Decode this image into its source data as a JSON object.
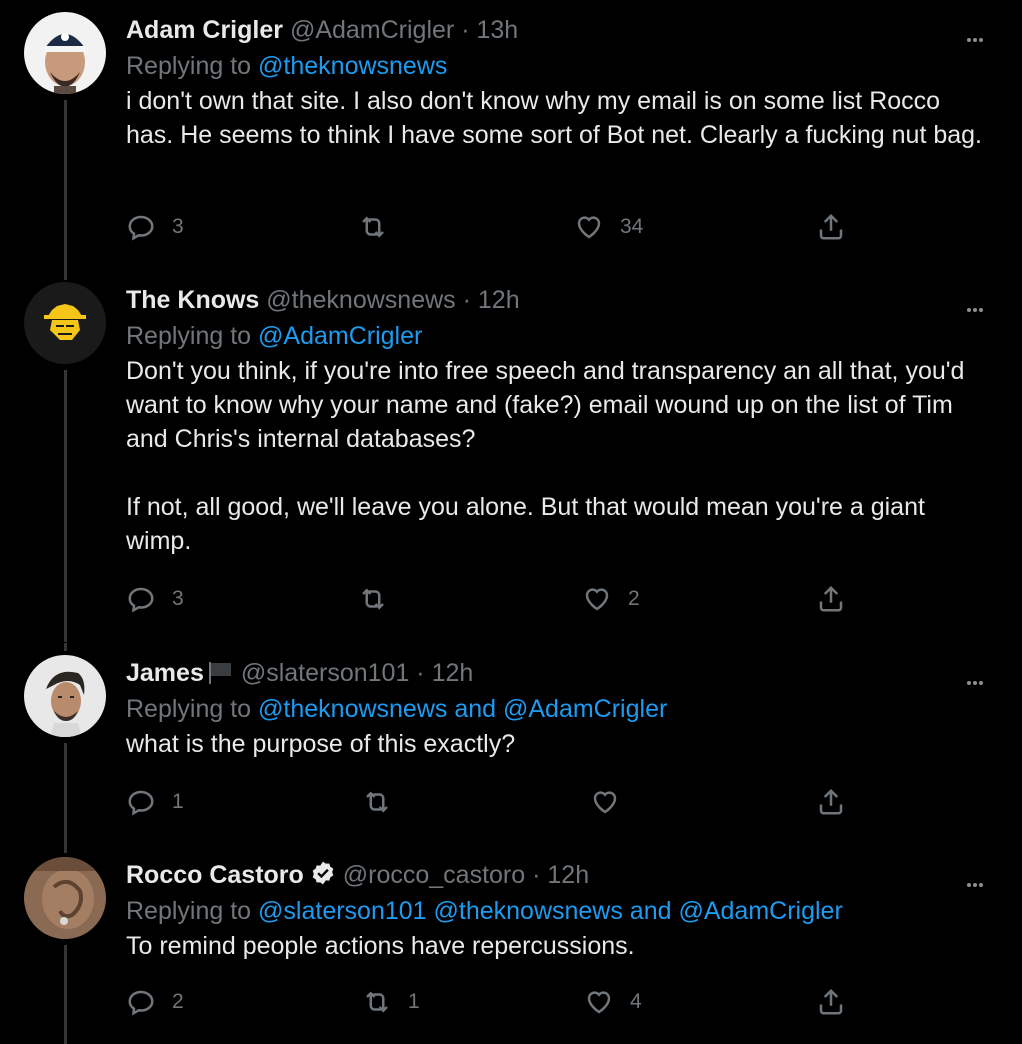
{
  "tweets": [
    {
      "name": "Adam Crigler",
      "handle": "@AdamCrigler",
      "sep": "·",
      "time": "13h",
      "replying_prefix": "Replying to",
      "replying_to": "@theknowsnews",
      "text": "i don't own that site.  I also don't know why my email is on some list Rocco has.  He seems to think I have some sort of Bot net.  Clearly a fucking nut bag.",
      "replies": "3",
      "retweets": "",
      "likes": "34",
      "avatar": "man-in-cap-avatar"
    },
    {
      "name": "The Knows",
      "handle": "@theknowsnews",
      "sep": "·",
      "time": "12h",
      "replying_prefix": "Replying to",
      "replying_to": "@AdamCrigler",
      "text": "Don't you think, if you're into free speech and transparency an all that, you'd want to know why your name and (fake?) email wound up on the list of Tim and Chris's internal databases?\n\nIf not, all good, we'll leave you alone. But that would mean you're a giant wimp.",
      "replies": "3",
      "retweets": "",
      "likes": "2",
      "avatar": "yellow-hat-logo-avatar"
    },
    {
      "name": "James",
      "handle": "@slaterson101",
      "sep": "·",
      "time": "12h",
      "replying_prefix": "Replying to",
      "replying_to": "@theknowsnews and @AdamCrigler",
      "text": "what is the purpose of this exactly?",
      "replies": "1",
      "retweets": "",
      "likes": "",
      "avatar": "man-portrait-avatar"
    },
    {
      "name": "Rocco Castoro",
      "handle": "@rocco_castoro",
      "sep": "·",
      "time": "12h",
      "replying_prefix": "Replying to",
      "replying_to": "@slaterson101 @theknowsnews and @AdamCrigler",
      "text": "To remind people actions have repercussions.",
      "replies": "2",
      "retweets": "1",
      "likes": "4",
      "avatar": "ear-closeup-avatar"
    }
  ],
  "colors": {
    "background": "#000000",
    "text": "#e7e9ea",
    "secondary": "#71767b",
    "link": "#1d9bf0",
    "verified": "#e7e9ea"
  }
}
